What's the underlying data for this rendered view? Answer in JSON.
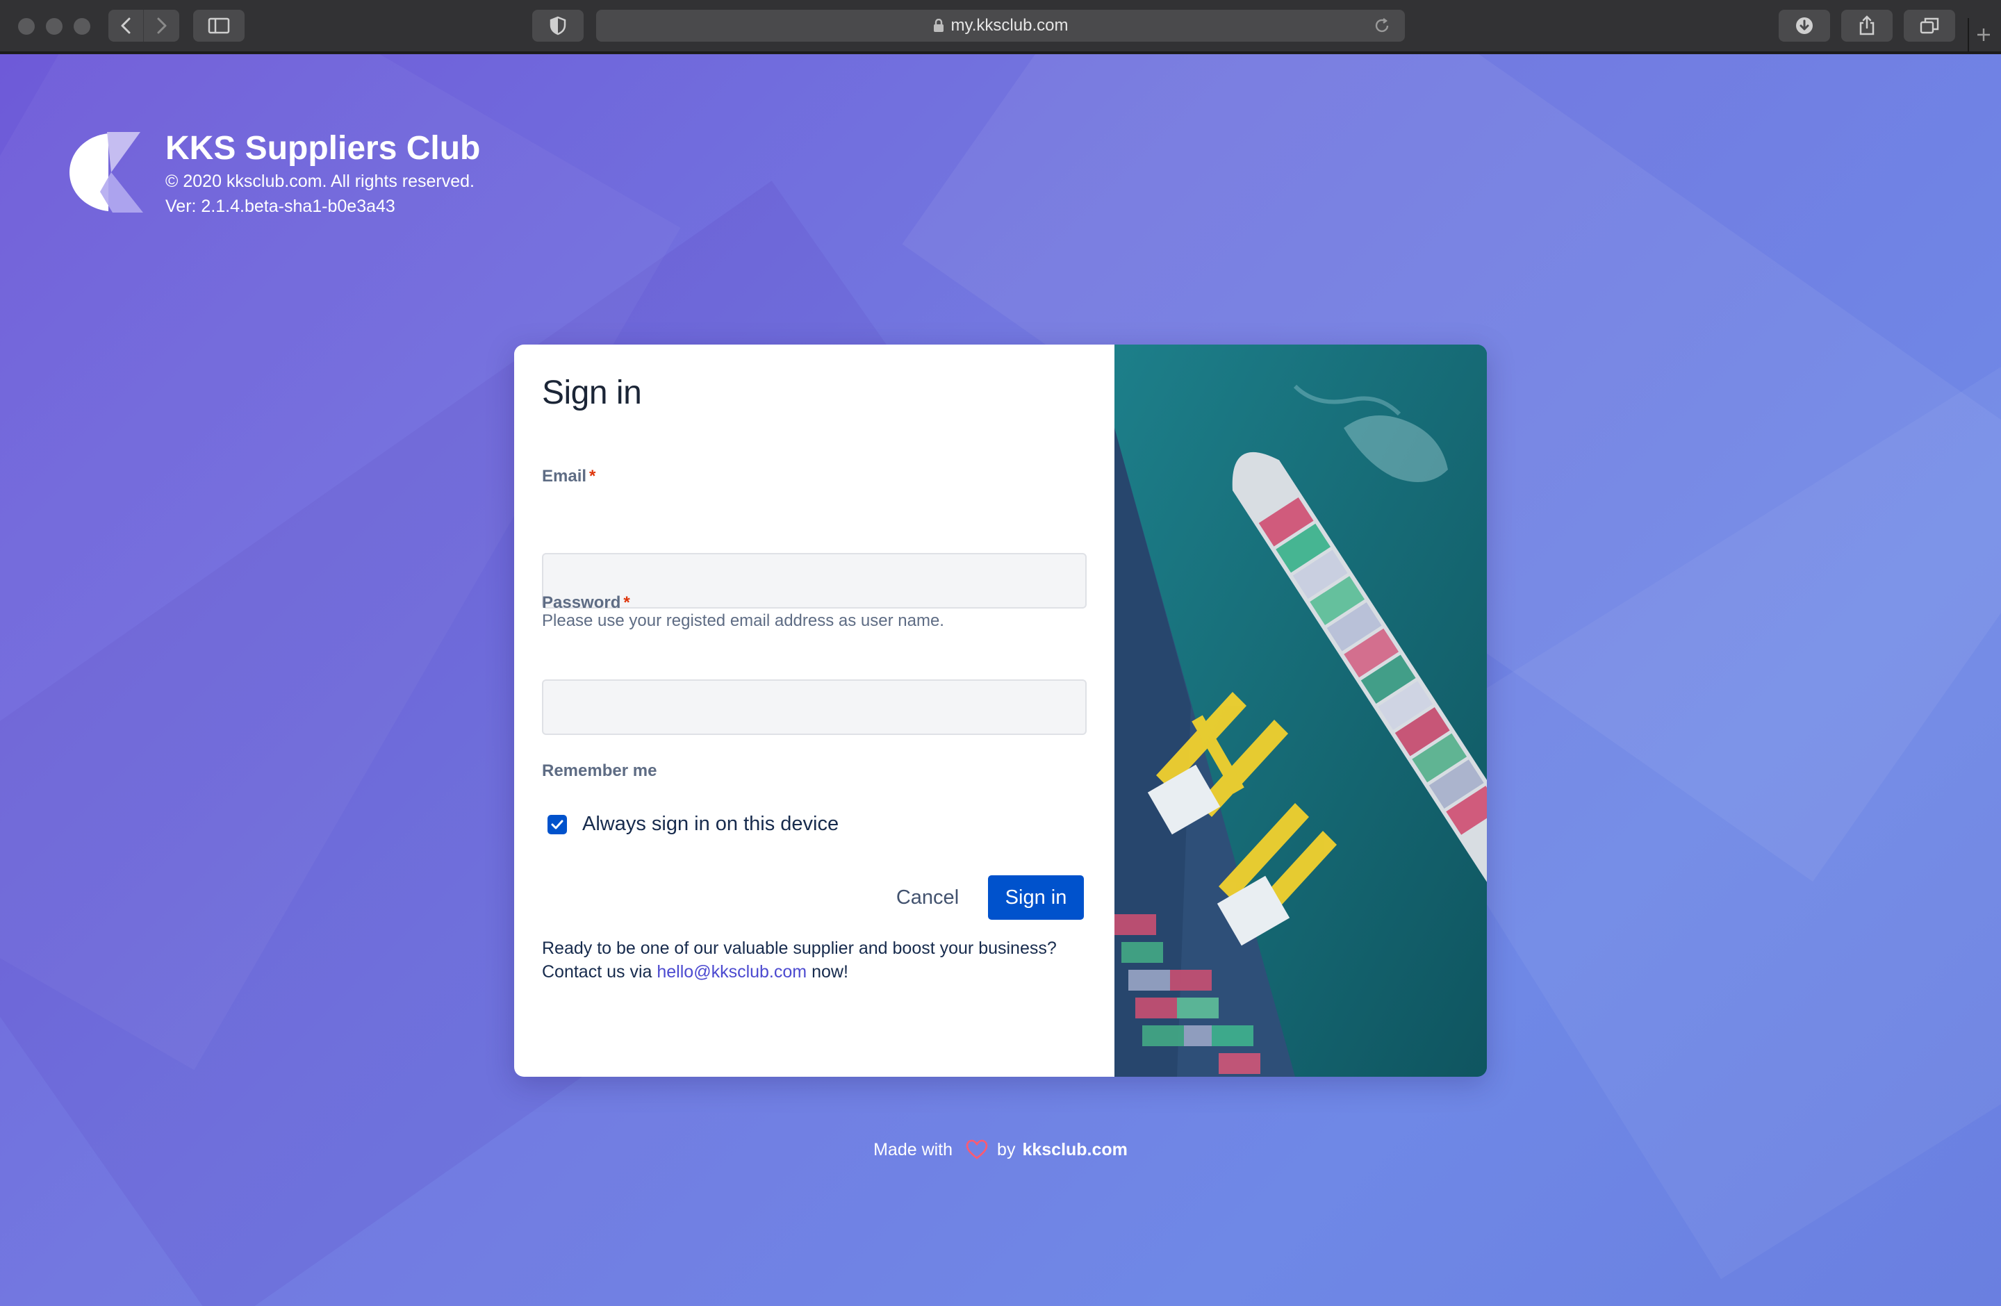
{
  "browser": {
    "url": "my.kksclub.com",
    "icons": [
      "back-icon",
      "forward-icon",
      "sidebar-icon",
      "shield-icon",
      "lock-icon",
      "reload-icon",
      "download-icon",
      "share-icon",
      "tabs-icon",
      "plus-icon"
    ]
  },
  "brand": {
    "title": "KKS Suppliers Club",
    "copyright": "© 2020 kksclub.com. All rights reserved.",
    "version": "Ver: 2.1.4.beta-sha1-b0e3a43"
  },
  "signin": {
    "title": "Sign in",
    "email_label": "Email",
    "email_value": "",
    "email_help": "Please use your registed email address as user name.",
    "password_label": "Password",
    "password_value": "",
    "required_mark": "*",
    "remember_label": "Remember me",
    "remember_option": "Always sign in on this device",
    "remember_checked": true,
    "cancel_label": "Cancel",
    "submit_label": "Sign in",
    "promo_line1": "Ready to be one of our valuable supplier and boost your business?",
    "promo_prefix": "Contact us via",
    "promo_email": "hello@kksclub.com",
    "promo_suffix": "now!"
  },
  "footer": {
    "made_with": "Made with",
    "by": "by",
    "site": "kksclub.com"
  },
  "colors": {
    "primary": "#0052cc",
    "required": "#de350b",
    "heart": "#ff5a70",
    "background_start": "#6e5ad8",
    "background_end": "#6a7fe0"
  }
}
